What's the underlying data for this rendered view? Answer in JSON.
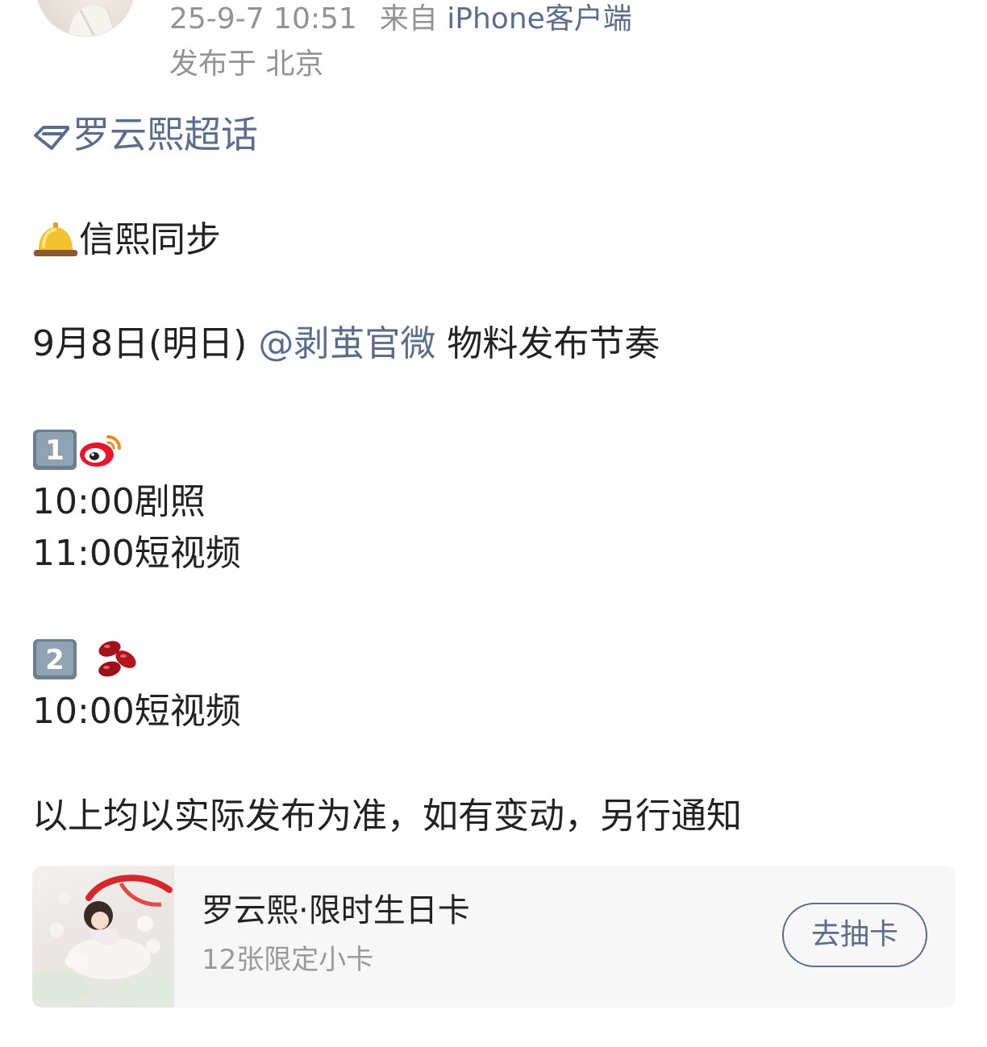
{
  "post": {
    "time": "25-9-7 10:51",
    "source_prefix": "来自",
    "source_client": "iPhone客户端",
    "location": "发布于 北京"
  },
  "topic": {
    "icon": "diamond-icon",
    "label": "罗云熙超话"
  },
  "content": {
    "bell_icon": "bell-emoji-icon",
    "line1": "信熙同步",
    "line2_prefix": "9月8日(明日)",
    "line2_mention": "@剥茧官微",
    "line2_suffix": "物料发布节奏",
    "keycap1_icon": "keycap-1-icon",
    "weibo_icon": "weibo-logo-icon",
    "sched1_a": "10:00剧照",
    "sched1_b": "11:00短视频",
    "keycap2_icon": "keycap-2-icon",
    "beans_icon": "red-beans-icon",
    "sched2_a": "10:00短视频",
    "notice": "以上均以实际发布为准，如有变动，另行通知"
  },
  "card": {
    "title": "罗云熙·限时生日卡",
    "subtitle": "12张限定小卡",
    "button": "去抽卡"
  },
  "colors": {
    "link": "#5b6d8c",
    "meta": "#939393",
    "text": "#222222",
    "card_bg": "#f7f7f7"
  }
}
